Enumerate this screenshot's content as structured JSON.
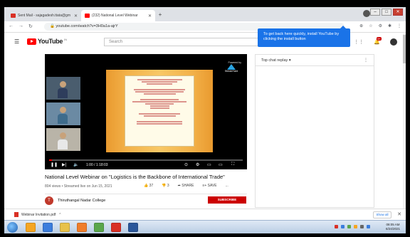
{
  "browser": {
    "tabs": [
      {
        "label": "Sent Mail - sajagadesh.ttata@gm",
        "favicon_color": "#d93025"
      },
      {
        "label": "(232) National Level Webinar",
        "favicon_color": "#ff0000"
      }
    ],
    "new_tab": "+",
    "url": "youtube.com/watch?v=3H0a1a-ajrY",
    "window_controls": {
      "minimize": "–",
      "maximize": "□",
      "close": "✕"
    }
  },
  "youtube": {
    "logo_text": "YouTube",
    "logo_suffix": "IN",
    "search_placeholder": "Search",
    "notification_count": "9+",
    "install_tooltip": "To get back here quickly, install YouTube by clicking the install button"
  },
  "video": {
    "powered_by": "Powered by",
    "streamyard": "StreamYard",
    "time": "1:00 / 1:18:03",
    "progress": 0.013,
    "title": "National Level Webinar on \"Logistics is the Backbone of International Trade\"",
    "meta": "804 views • Streamed live on Jun 15, 2021",
    "likes": "37",
    "dislikes": "3",
    "share": "SHARE",
    "save": "SAVE",
    "more": "...",
    "channel_name": "Thiruthangal Nadar College",
    "channel_initial": "T",
    "subscribe": "SUBSCRIBE"
  },
  "chat": {
    "header": "Top chat replay ▾",
    "more": "⋮"
  },
  "download": {
    "file": "Webinar Invitation.pdf",
    "show_all": "Show all",
    "close": "✕"
  },
  "taskbar": {
    "icon_colors": [
      "#f5a623",
      "#3b7ddd",
      "#e8c24a",
      "#f07d2b",
      "#5aa64b",
      "#d93025",
      "#2b579a"
    ],
    "time": "08:05 AM",
    "date": "6/24/2021"
  }
}
